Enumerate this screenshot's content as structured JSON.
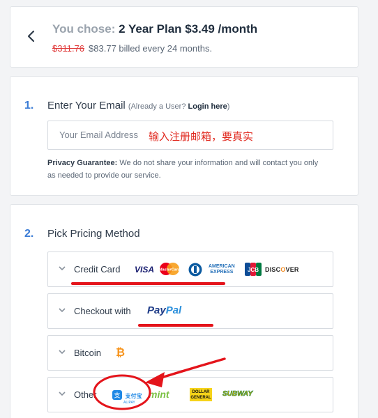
{
  "plan": {
    "prefix": "You chose:",
    "name": "2 Year Plan $3.49 /month",
    "original_price": "$311.76",
    "billing": "$83.77 billed every 24 months."
  },
  "email_step": {
    "number": "1.",
    "title": "Enter Your Email",
    "hint_open": "(Already a User?",
    "login_link": "Login here",
    "hint_close": ")",
    "placeholder": "Your Email Address",
    "annotation": "输入注册邮箱，要真实",
    "privacy_label": "Privacy Guarantee:",
    "privacy_text": "We do not share your information and will contact you only as needed to provide our service."
  },
  "pricing_step": {
    "number": "2.",
    "title": "Pick Pricing Method",
    "methods": [
      {
        "label": "Credit Card",
        "logos": [
          "visa-logo",
          "mastercard-logo",
          "diners-logo",
          "amex-logo",
          "jcb-logo",
          "discover-logo"
        ]
      },
      {
        "label": "Checkout with",
        "logos": [
          "paypal-logo"
        ]
      },
      {
        "label": "Bitcoin",
        "logos": [
          "bitcoin-logo"
        ]
      },
      {
        "label": "Other",
        "logos": [
          "alipay-logo",
          "mint-logo",
          "dollar-general-logo",
          "subway-logo"
        ]
      }
    ]
  },
  "logo_text": {
    "visa": "VISA",
    "mastercard": "MasterCard",
    "amex_1": "AMERICAN",
    "amex_2": "EXPRESS",
    "jcb": "JCB",
    "discover_a": "DISC",
    "discover_o": "O",
    "discover_b": "VER",
    "paypal_a": "Pay",
    "paypal_b": "Pal",
    "bitcoin": "₿",
    "alipay": "支付宝",
    "alipay_sub": "ALIPAY",
    "mint": "mint",
    "dollar_general_1": "DOLLAR",
    "dollar_general_2": "GENERAL",
    "subway": "SUBWAY"
  },
  "colors": {
    "accent_blue": "#3a7bd5",
    "annotation_red": "#e0261c",
    "strike_red": "#e03c3c"
  }
}
